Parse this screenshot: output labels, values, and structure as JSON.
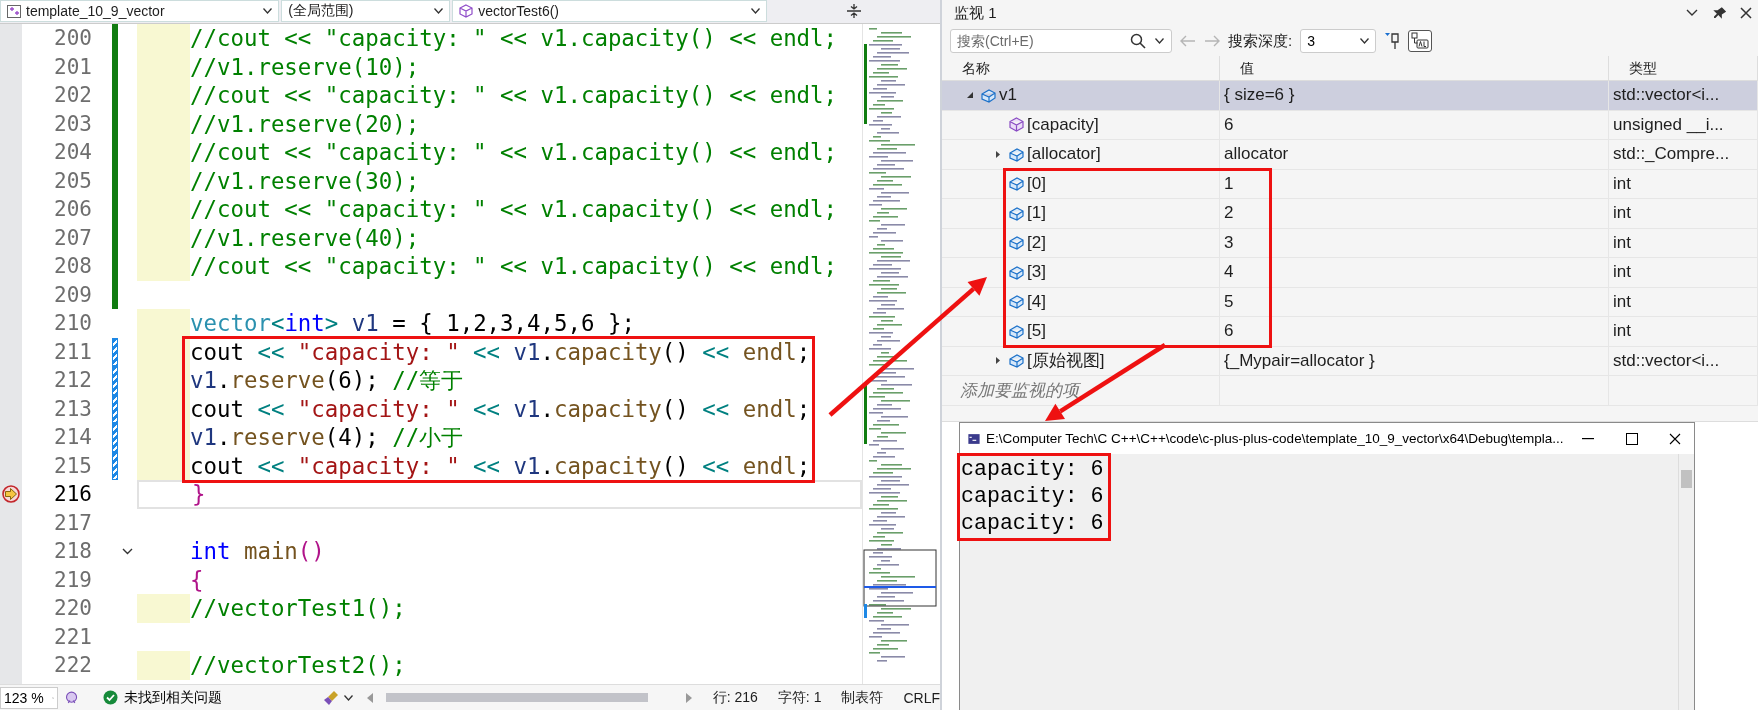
{
  "editor_nav": {
    "project": "template_10_9_vector",
    "scope": "(全局范围)",
    "function": "vectorTest6()"
  },
  "code_lines": [
    {
      "number": "200",
      "indented": true,
      "kind": "saved",
      "current": false,
      "fold_start": false,
      "segments": [
        {
          "kind": "comment",
          "text": "//cout << \"capacity: \" << v1.capacity() << endl;"
        }
      ]
    },
    {
      "number": "201",
      "indented": true,
      "kind": "saved",
      "current": false,
      "fold_start": false,
      "segments": [
        {
          "kind": "comment",
          "text": "//v1.reserve(10);"
        }
      ]
    },
    {
      "number": "202",
      "indented": true,
      "kind": "saved",
      "current": false,
      "fold_start": false,
      "segments": [
        {
          "kind": "comment",
          "text": "//cout << \"capacity: \" << v1.capacity() << endl;"
        }
      ]
    },
    {
      "number": "203",
      "indented": true,
      "kind": "saved",
      "current": false,
      "fold_start": false,
      "segments": [
        {
          "kind": "comment",
          "text": "//v1.reserve(20);"
        }
      ]
    },
    {
      "number": "204",
      "indented": true,
      "kind": "saved",
      "current": false,
      "fold_start": false,
      "segments": [
        {
          "kind": "comment",
          "text": "//cout << \"capacity: \" << v1.capacity() << endl;"
        }
      ]
    },
    {
      "number": "205",
      "indented": true,
      "kind": "saved",
      "current": false,
      "fold_start": false,
      "segments": [
        {
          "kind": "comment",
          "text": "//v1.reserve(30);"
        }
      ]
    },
    {
      "number": "206",
      "indented": true,
      "kind": "saved",
      "current": false,
      "fold_start": false,
      "segments": [
        {
          "kind": "comment",
          "text": "//cout << \"capacity: \" << v1.capacity() << endl;"
        }
      ]
    },
    {
      "number": "207",
      "indented": true,
      "kind": "saved",
      "current": false,
      "fold_start": false,
      "segments": [
        {
          "kind": "comment",
          "text": "//v1.reserve(40);"
        }
      ]
    },
    {
      "number": "208",
      "indented": true,
      "kind": "saved",
      "current": false,
      "fold_start": false,
      "segments": [
        {
          "kind": "comment",
          "text": "//cout << \"capacity: \" << v1.capacity() << endl;"
        }
      ]
    },
    {
      "number": "209",
      "indented": false,
      "kind": "saved",
      "current": false,
      "fold_start": false
    },
    {
      "number": "210",
      "indented": true,
      "kind": "plain",
      "current": false,
      "fold_start": false,
      "segments": [
        {
          "kind": "type",
          "text": "vector"
        },
        {
          "kind": "op",
          "text": "<"
        },
        {
          "kind": "keyword",
          "text": "int"
        },
        {
          "kind": "op",
          "text": "> "
        },
        {
          "kind": "var",
          "text": "v1"
        },
        {
          "kind": "plain",
          "text": " = { 1,2,3,4,5,6 };"
        }
      ]
    },
    {
      "number": "211",
      "indented": true,
      "kind": "unsaved",
      "current": false,
      "fold_start": false,
      "segments": [
        {
          "kind": "plain",
          "text": "cout "
        },
        {
          "kind": "op",
          "text": "<< "
        },
        {
          "kind": "string",
          "text": "\"capacity: \""
        },
        {
          "kind": "op",
          "text": " << "
        },
        {
          "kind": "var",
          "text": "v1"
        },
        {
          "kind": "plain",
          "text": "."
        },
        {
          "kind": "fn",
          "text": "capacity"
        },
        {
          "kind": "plain",
          "text": "() "
        },
        {
          "kind": "op",
          "text": "<< "
        },
        {
          "kind": "fn",
          "text": "endl"
        },
        {
          "kind": "plain",
          "text": ";"
        }
      ]
    },
    {
      "number": "212",
      "indented": true,
      "kind": "unsaved",
      "current": false,
      "fold_start": false,
      "segments": [
        {
          "kind": "var",
          "text": "v1"
        },
        {
          "kind": "plain",
          "text": "."
        },
        {
          "kind": "fn",
          "text": "reserve"
        },
        {
          "kind": "plain",
          "text": "(6); "
        },
        {
          "kind": "comment",
          "text": "//等于"
        }
      ]
    },
    {
      "number": "213",
      "indented": true,
      "kind": "unsaved",
      "current": false,
      "fold_start": false,
      "segments": [
        {
          "kind": "plain",
          "text": "cout "
        },
        {
          "kind": "op",
          "text": "<< "
        },
        {
          "kind": "string",
          "text": "\"capacity: \""
        },
        {
          "kind": "op",
          "text": " << "
        },
        {
          "kind": "var",
          "text": "v1"
        },
        {
          "kind": "plain",
          "text": "."
        },
        {
          "kind": "fn",
          "text": "capacity"
        },
        {
          "kind": "plain",
          "text": "() "
        },
        {
          "kind": "op",
          "text": "<< "
        },
        {
          "kind": "fn",
          "text": "endl"
        },
        {
          "kind": "plain",
          "text": ";"
        }
      ]
    },
    {
      "number": "214",
      "indented": true,
      "kind": "unsaved",
      "current": false,
      "fold_start": false,
      "segments": [
        {
          "kind": "var",
          "text": "v1"
        },
        {
          "kind": "plain",
          "text": "."
        },
        {
          "kind": "fn",
          "text": "reserve"
        },
        {
          "kind": "plain",
          "text": "(4); "
        },
        {
          "kind": "comment",
          "text": "//小于"
        }
      ]
    },
    {
      "number": "215",
      "indented": true,
      "kind": "unsaved",
      "current": false,
      "fold_start": false,
      "segments": [
        {
          "kind": "plain",
          "text": "cout "
        },
        {
          "kind": "op",
          "text": "<< "
        },
        {
          "kind": "string",
          "text": "\"capacity: \""
        },
        {
          "kind": "op",
          "text": " << "
        },
        {
          "kind": "var",
          "text": "v1"
        },
        {
          "kind": "plain",
          "text": "."
        },
        {
          "kind": "fn",
          "text": "capacity"
        },
        {
          "kind": "plain",
          "text": "() "
        },
        {
          "kind": "op",
          "text": "<< "
        },
        {
          "kind": "fn",
          "text": "endl"
        },
        {
          "kind": "plain",
          "text": ";"
        }
      ]
    },
    {
      "number": "216",
      "indented": false,
      "kind": "plain",
      "current": true,
      "fold_start": false,
      "segments": [
        {
          "kind": "brace",
          "text": "}"
        }
      ]
    },
    {
      "number": "217",
      "indented": false,
      "kind": "plain",
      "current": false,
      "fold_start": false
    },
    {
      "number": "218",
      "indented": false,
      "kind": "plain",
      "current": false,
      "fold_start": true,
      "segments": [
        {
          "kind": "keyword",
          "text": "int "
        },
        {
          "kind": "fn",
          "text": "main"
        },
        {
          "kind": "brace",
          "text": "()"
        }
      ]
    },
    {
      "number": "219",
      "indented": false,
      "kind": "plain",
      "current": false,
      "fold_start": false,
      "segments": [
        {
          "kind": "brace",
          "text": "{"
        }
      ]
    },
    {
      "number": "220",
      "indented": true,
      "kind": "plain",
      "current": false,
      "fold_start": false,
      "segments": [
        {
          "kind": "comment",
          "text": "//vectorTest1();"
        }
      ]
    },
    {
      "number": "221",
      "indented": false,
      "kind": "plain",
      "current": false,
      "fold_start": false
    },
    {
      "number": "222",
      "indented": true,
      "kind": "plain",
      "current": false,
      "fold_start": false,
      "segments": [
        {
          "kind": "comment",
          "text": "//vectorTest2();"
        }
      ]
    }
  ],
  "status_bar": {
    "zoom": "123 %",
    "issues": "未找到相关问题",
    "line": "行: 216",
    "char": "字符: 1",
    "indent": "制表符",
    "eol": "CRLF"
  },
  "watch": {
    "title": "监视 1",
    "search": {
      "placeholder": "搜索(Ctrl+E)"
    },
    "depth_label": "搜索深度:",
    "depth_value": "3",
    "columns": [
      "名称",
      "值",
      "类型"
    ],
    "rows": [
      {
        "name": "v1",
        "value": "{ size=6 }",
        "type": "std::vector<i...",
        "kind": "field",
        "expanded": true,
        "selected": true,
        "children": [
          {
            "name": "[capacity]",
            "value": "6",
            "type": "unsigned __i...",
            "kind": "property",
            "selected": false
          },
          {
            "name": "[allocator]",
            "value": "allocator",
            "type": "std::_Compre...",
            "kind": "field",
            "expanded": false,
            "selected": false
          },
          {
            "name": "[0]",
            "value": "1",
            "type": "int",
            "kind": "field",
            "selected": false
          },
          {
            "name": "[1]",
            "value": "2",
            "type": "int",
            "kind": "field",
            "selected": false
          },
          {
            "name": "[2]",
            "value": "3",
            "type": "int",
            "kind": "field",
            "selected": false
          },
          {
            "name": "[3]",
            "value": "4",
            "type": "int",
            "kind": "field",
            "selected": false
          },
          {
            "name": "[4]",
            "value": "5",
            "type": "int",
            "kind": "field",
            "selected": false
          },
          {
            "name": "[5]",
            "value": "6",
            "type": "int",
            "kind": "field",
            "selected": false
          },
          {
            "name": "[原始视图]",
            "value": "{_Mypair=allocator }",
            "type": "std::vector<i...",
            "kind": "field",
            "expanded": false,
            "selected": false
          }
        ]
      }
    ],
    "add_placeholder": "添加要监视的项"
  },
  "console": {
    "title": "E:\\Computer Tech\\C C++\\C++\\code\\c-plus-plus-code\\template_10_9_vector\\x64\\Debug\\templa...",
    "lines": [
      "capacity: 6",
      "capacity: 6",
      "capacity: 6"
    ]
  }
}
